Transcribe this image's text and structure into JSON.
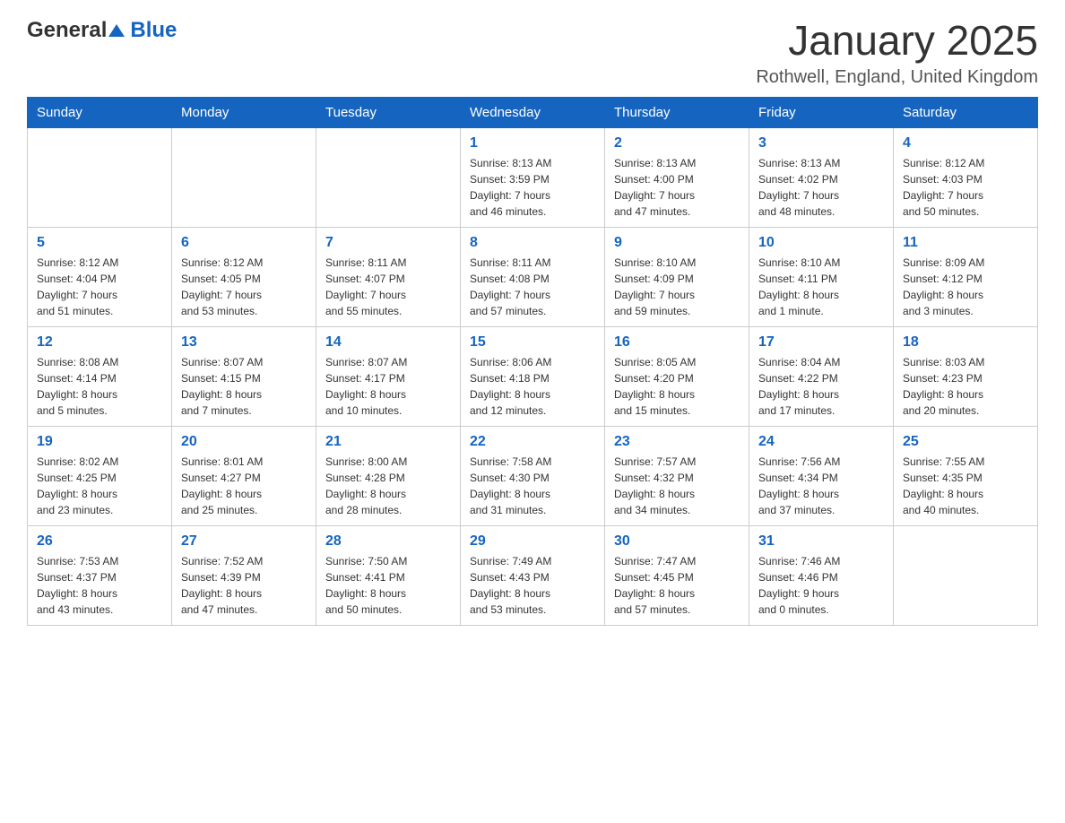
{
  "header": {
    "logo_general": "General",
    "logo_blue": "Blue",
    "month_year": "January 2025",
    "location": "Rothwell, England, United Kingdom"
  },
  "weekdays": [
    "Sunday",
    "Monday",
    "Tuesday",
    "Wednesday",
    "Thursday",
    "Friday",
    "Saturday"
  ],
  "weeks": [
    [
      {
        "day": "",
        "info": ""
      },
      {
        "day": "",
        "info": ""
      },
      {
        "day": "",
        "info": ""
      },
      {
        "day": "1",
        "info": "Sunrise: 8:13 AM\nSunset: 3:59 PM\nDaylight: 7 hours\nand 46 minutes."
      },
      {
        "day": "2",
        "info": "Sunrise: 8:13 AM\nSunset: 4:00 PM\nDaylight: 7 hours\nand 47 minutes."
      },
      {
        "day": "3",
        "info": "Sunrise: 8:13 AM\nSunset: 4:02 PM\nDaylight: 7 hours\nand 48 minutes."
      },
      {
        "day": "4",
        "info": "Sunrise: 8:12 AM\nSunset: 4:03 PM\nDaylight: 7 hours\nand 50 minutes."
      }
    ],
    [
      {
        "day": "5",
        "info": "Sunrise: 8:12 AM\nSunset: 4:04 PM\nDaylight: 7 hours\nand 51 minutes."
      },
      {
        "day": "6",
        "info": "Sunrise: 8:12 AM\nSunset: 4:05 PM\nDaylight: 7 hours\nand 53 minutes."
      },
      {
        "day": "7",
        "info": "Sunrise: 8:11 AM\nSunset: 4:07 PM\nDaylight: 7 hours\nand 55 minutes."
      },
      {
        "day": "8",
        "info": "Sunrise: 8:11 AM\nSunset: 4:08 PM\nDaylight: 7 hours\nand 57 minutes."
      },
      {
        "day": "9",
        "info": "Sunrise: 8:10 AM\nSunset: 4:09 PM\nDaylight: 7 hours\nand 59 minutes."
      },
      {
        "day": "10",
        "info": "Sunrise: 8:10 AM\nSunset: 4:11 PM\nDaylight: 8 hours\nand 1 minute."
      },
      {
        "day": "11",
        "info": "Sunrise: 8:09 AM\nSunset: 4:12 PM\nDaylight: 8 hours\nand 3 minutes."
      }
    ],
    [
      {
        "day": "12",
        "info": "Sunrise: 8:08 AM\nSunset: 4:14 PM\nDaylight: 8 hours\nand 5 minutes."
      },
      {
        "day": "13",
        "info": "Sunrise: 8:07 AM\nSunset: 4:15 PM\nDaylight: 8 hours\nand 7 minutes."
      },
      {
        "day": "14",
        "info": "Sunrise: 8:07 AM\nSunset: 4:17 PM\nDaylight: 8 hours\nand 10 minutes."
      },
      {
        "day": "15",
        "info": "Sunrise: 8:06 AM\nSunset: 4:18 PM\nDaylight: 8 hours\nand 12 minutes."
      },
      {
        "day": "16",
        "info": "Sunrise: 8:05 AM\nSunset: 4:20 PM\nDaylight: 8 hours\nand 15 minutes."
      },
      {
        "day": "17",
        "info": "Sunrise: 8:04 AM\nSunset: 4:22 PM\nDaylight: 8 hours\nand 17 minutes."
      },
      {
        "day": "18",
        "info": "Sunrise: 8:03 AM\nSunset: 4:23 PM\nDaylight: 8 hours\nand 20 minutes."
      }
    ],
    [
      {
        "day": "19",
        "info": "Sunrise: 8:02 AM\nSunset: 4:25 PM\nDaylight: 8 hours\nand 23 minutes."
      },
      {
        "day": "20",
        "info": "Sunrise: 8:01 AM\nSunset: 4:27 PM\nDaylight: 8 hours\nand 25 minutes."
      },
      {
        "day": "21",
        "info": "Sunrise: 8:00 AM\nSunset: 4:28 PM\nDaylight: 8 hours\nand 28 minutes."
      },
      {
        "day": "22",
        "info": "Sunrise: 7:58 AM\nSunset: 4:30 PM\nDaylight: 8 hours\nand 31 minutes."
      },
      {
        "day": "23",
        "info": "Sunrise: 7:57 AM\nSunset: 4:32 PM\nDaylight: 8 hours\nand 34 minutes."
      },
      {
        "day": "24",
        "info": "Sunrise: 7:56 AM\nSunset: 4:34 PM\nDaylight: 8 hours\nand 37 minutes."
      },
      {
        "day": "25",
        "info": "Sunrise: 7:55 AM\nSunset: 4:35 PM\nDaylight: 8 hours\nand 40 minutes."
      }
    ],
    [
      {
        "day": "26",
        "info": "Sunrise: 7:53 AM\nSunset: 4:37 PM\nDaylight: 8 hours\nand 43 minutes."
      },
      {
        "day": "27",
        "info": "Sunrise: 7:52 AM\nSunset: 4:39 PM\nDaylight: 8 hours\nand 47 minutes."
      },
      {
        "day": "28",
        "info": "Sunrise: 7:50 AM\nSunset: 4:41 PM\nDaylight: 8 hours\nand 50 minutes."
      },
      {
        "day": "29",
        "info": "Sunrise: 7:49 AM\nSunset: 4:43 PM\nDaylight: 8 hours\nand 53 minutes."
      },
      {
        "day": "30",
        "info": "Sunrise: 7:47 AM\nSunset: 4:45 PM\nDaylight: 8 hours\nand 57 minutes."
      },
      {
        "day": "31",
        "info": "Sunrise: 7:46 AM\nSunset: 4:46 PM\nDaylight: 9 hours\nand 0 minutes."
      },
      {
        "day": "",
        "info": ""
      }
    ]
  ]
}
